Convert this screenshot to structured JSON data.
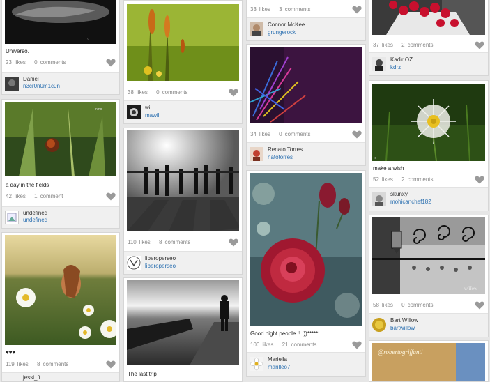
{
  "cards": [
    {
      "id": "c1",
      "caption": "Universo.",
      "likes": "23",
      "likes_label": "likes",
      "comments": "0",
      "comments_label": "comments",
      "user_name": "Daniel",
      "user_login": "n3cr0n0m1c0n"
    },
    {
      "id": "c2",
      "caption": "a day in the fields",
      "likes": "42",
      "likes_label": "likes",
      "comments": "1",
      "comments_label": "comment",
      "user_name": "undefined",
      "user_login": "undefined"
    },
    {
      "id": "c3",
      "caption": "♥♥♥",
      "likes": "119",
      "likes_label": "likes",
      "comments": "8",
      "comments_label": "comments",
      "user_name": "jessi_ft",
      "user_login": ""
    },
    {
      "id": "c4",
      "caption": "",
      "likes": "38",
      "likes_label": "likes",
      "comments": "0",
      "comments_label": "comments",
      "user_name": "wil",
      "user_login": "mawil"
    },
    {
      "id": "c5",
      "caption": "",
      "likes": "110",
      "likes_label": "likes",
      "comments": "8",
      "comments_label": "comments",
      "user_name": "liberoperseo",
      "user_login": "liberoperseo"
    },
    {
      "id": "c6",
      "caption": "The last trip",
      "likes": "",
      "likes_label": "",
      "comments": "",
      "comments_label": "",
      "user_name": "",
      "user_login": ""
    },
    {
      "id": "c7",
      "caption": "",
      "likes": "33",
      "likes_label": "likes",
      "comments": "3",
      "comments_label": "comments",
      "user_name": "Connor McKee.",
      "user_login": "grungerock"
    },
    {
      "id": "c8",
      "caption": "",
      "likes": "34",
      "likes_label": "likes",
      "comments": "0",
      "comments_label": "comments",
      "user_name": "Renato Torres",
      "user_login": "natotorres"
    },
    {
      "id": "c9",
      "caption": "Good night people !! :))*****",
      "likes": "100",
      "likes_label": "likes",
      "comments": "21",
      "comments_label": "comments",
      "user_name": "Mariella",
      "user_login": "marilleo7"
    },
    {
      "id": "c10",
      "caption": "",
      "likes": "37",
      "likes_label": "likes",
      "comments": "2",
      "comments_label": "comments",
      "user_name": "Kadir OZ",
      "user_login": "kdrz"
    },
    {
      "id": "c11",
      "caption": "make a wish",
      "likes": "52",
      "likes_label": "likes",
      "comments": "2",
      "comments_label": "comments",
      "user_name": "skunxy",
      "user_login": "mohicanchef182"
    },
    {
      "id": "c12",
      "caption": "",
      "likes": "58",
      "likes_label": "likes",
      "comments": "0",
      "comments_label": "comments",
      "user_name": "Bart Willow",
      "user_login": "bartwillow"
    }
  ],
  "photo_texts": {
    "robertogriffanti": "@robertogriffanti",
    "willow": "willow"
  },
  "colors": {
    "link": "#2a6fb0",
    "heart": "#9a9a9a",
    "bar": "#f0f0f0"
  }
}
